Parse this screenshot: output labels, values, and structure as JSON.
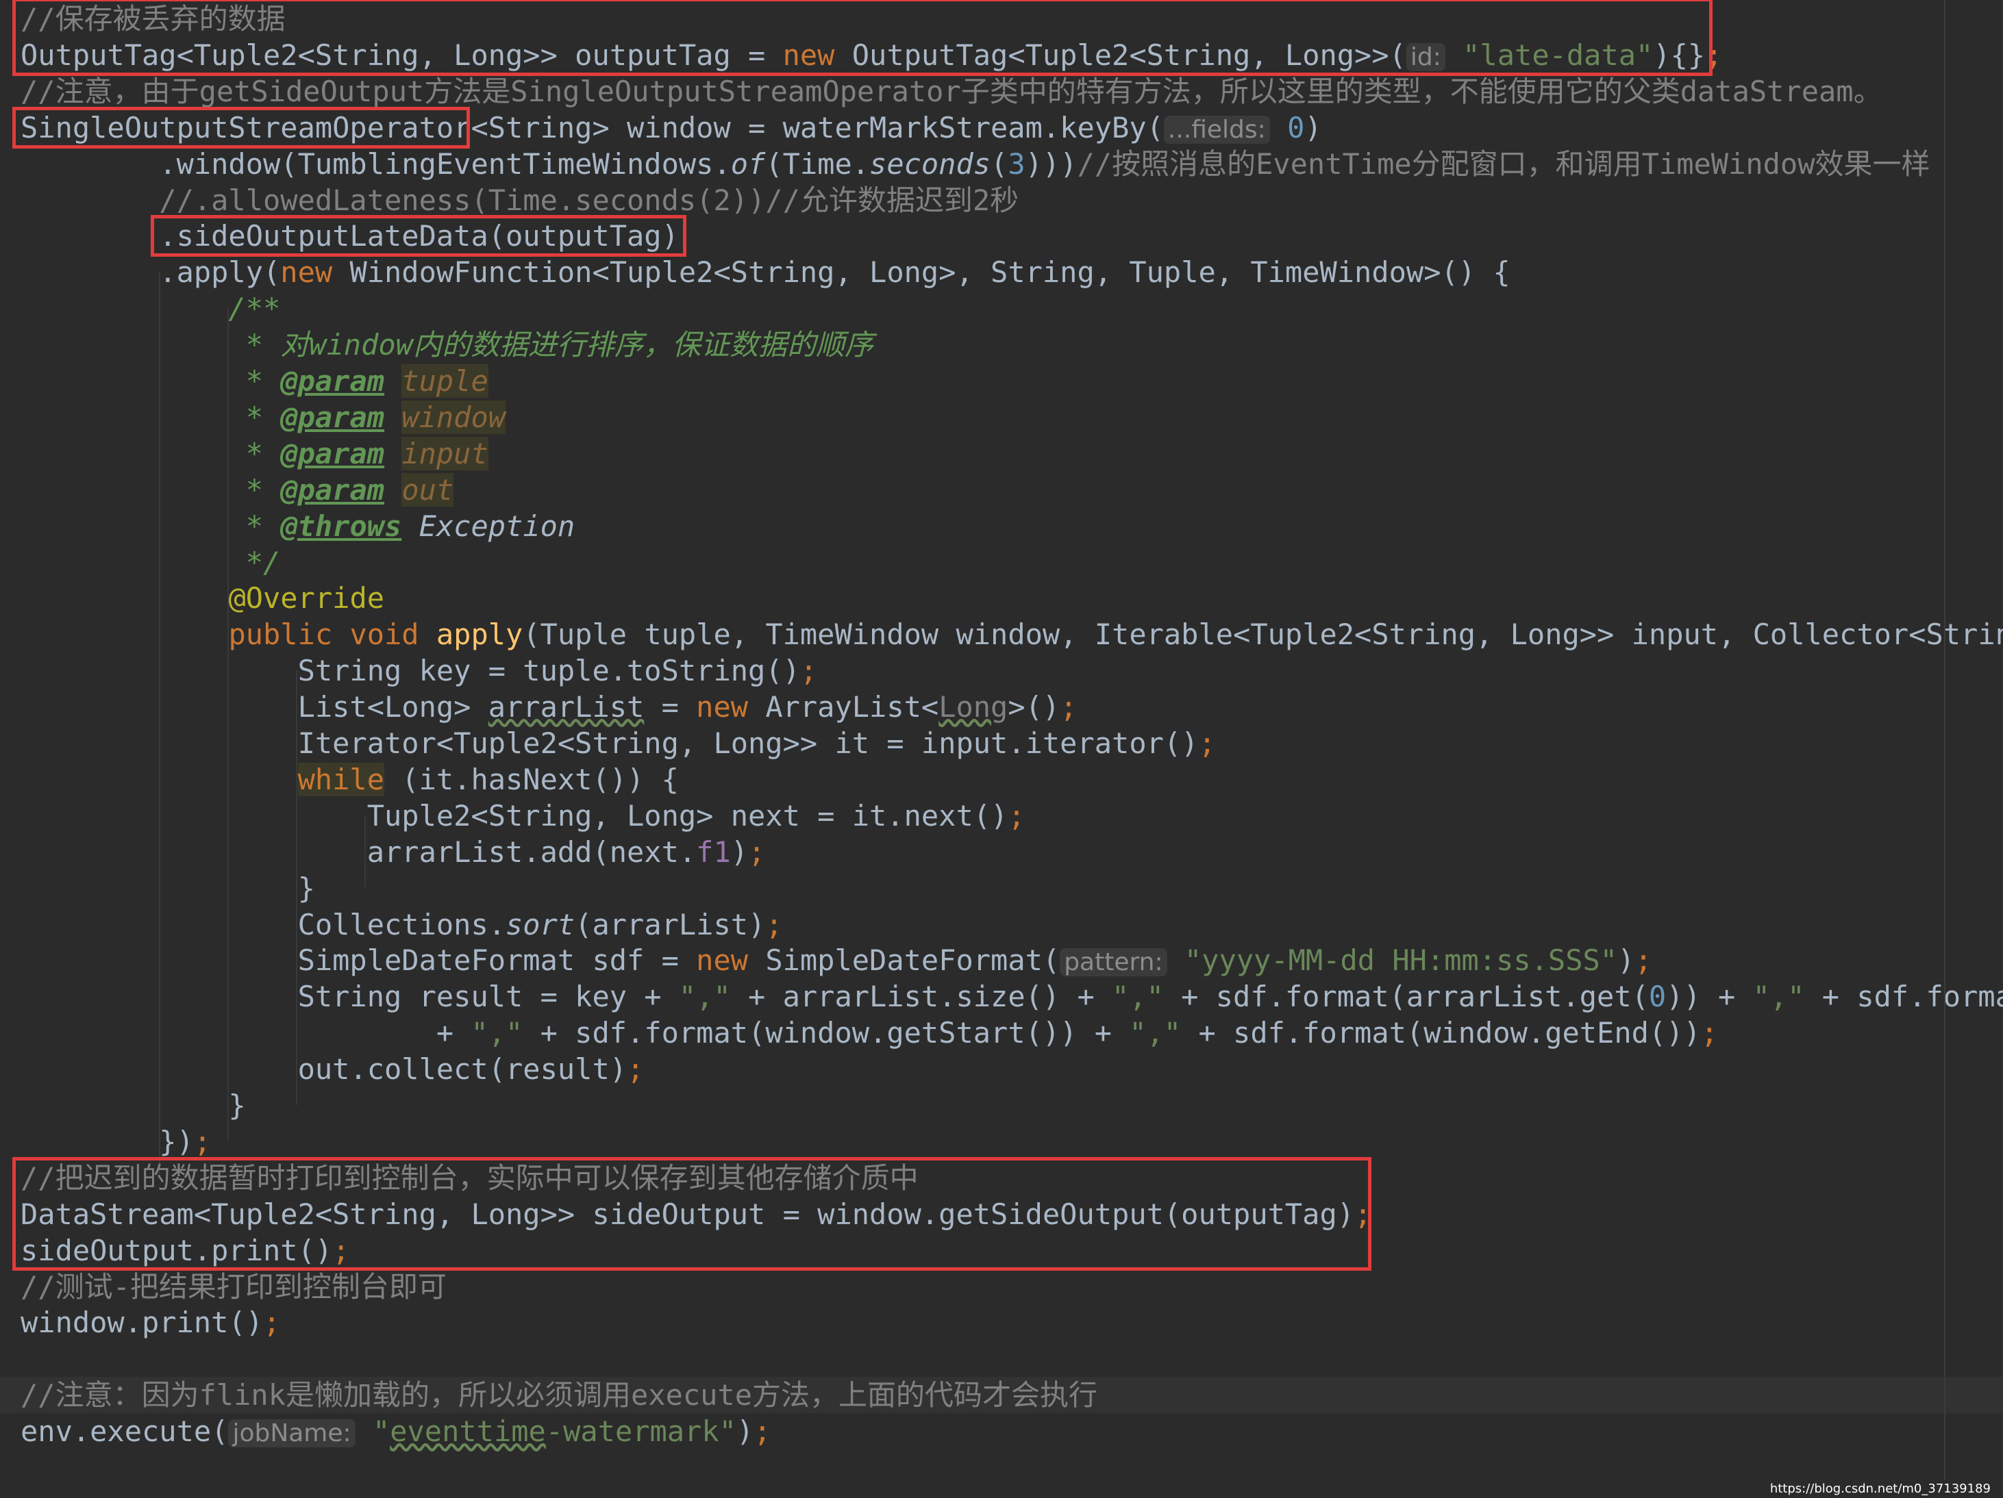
{
  "code_lines": [
    [
      {
        "t": "//保存被丢弃的数据",
        "s": "comment"
      }
    ],
    [
      {
        "t": "OutputTag<Tuple2<String, Long>> outputTag = ",
        "s": "normal"
      },
      {
        "t": "new ",
        "s": "keyword"
      },
      {
        "t": "OutputTag<Tuple2<String, Long>>(",
        "s": "normal"
      },
      {
        "t": "id:",
        "s": "hint"
      },
      {
        "t": " \"late-data\"",
        "s": "string"
      },
      {
        "t": "){}",
        "s": "normal"
      },
      {
        "t": ";",
        "s": "keyword"
      }
    ],
    [
      {
        "t": "//注意，由于getSideOutput方法是SingleOutputStreamOperator子类中的特有方法，所以这里的类型，不能使用它的父类dataStream。",
        "s": "comment"
      }
    ],
    [
      {
        "t": "SingleOutputStreamOperator<String> window = waterMarkStream.keyBy(",
        "s": "normal"
      },
      {
        "t": "...fields:",
        "s": "hint"
      },
      {
        "t": " 0",
        "s": "number"
      },
      {
        "t": ")",
        "s": "normal"
      }
    ],
    [
      {
        "t": "        .window(TumblingEventTimeWindows.",
        "s": "normal"
      },
      {
        "t": "of",
        "s": "italic"
      },
      {
        "t": "(Time.",
        "s": "normal"
      },
      {
        "t": "seconds",
        "s": "italic"
      },
      {
        "t": "(",
        "s": "normal"
      },
      {
        "t": "3",
        "s": "number"
      },
      {
        "t": ")))",
        "s": "normal"
      },
      {
        "t": "//按照消息的EventTime分配窗口，和调用TimeWindow效果一样",
        "s": "comment"
      }
    ],
    [
      {
        "t": "        //.allowedLateness(Time.seconds(2))//允许数据迟到2秒",
        "s": "comment"
      }
    ],
    [
      {
        "t": "        .sideOutputLateData(outputTag)",
        "s": "normal"
      }
    ],
    [
      {
        "t": "        .apply(",
        "s": "normal"
      },
      {
        "t": "new ",
        "s": "keyword"
      },
      {
        "t": "WindowFunction<Tuple2<String, Long>, String, Tuple, TimeWindow>() {",
        "s": "normal"
      }
    ],
    [
      {
        "t": "            /**",
        "s": "doc"
      }
    ],
    [
      {
        "t": "             * 对window内的数据进行排序，保证数据的顺序",
        "s": "doc"
      }
    ],
    [
      {
        "t": "             * ",
        "s": "doc"
      },
      {
        "t": "@param",
        "s": "doctag"
      },
      {
        "t": " ",
        "s": "doc"
      },
      {
        "t": "tuple",
        "s": "docparam"
      }
    ],
    [
      {
        "t": "             * ",
        "s": "doc"
      },
      {
        "t": "@param",
        "s": "doctag"
      },
      {
        "t": " ",
        "s": "doc"
      },
      {
        "t": "window",
        "s": "docparam"
      }
    ],
    [
      {
        "t": "             * ",
        "s": "doc"
      },
      {
        "t": "@param",
        "s": "doctag"
      },
      {
        "t": " ",
        "s": "doc"
      },
      {
        "t": "input",
        "s": "docparam"
      }
    ],
    [
      {
        "t": "             * ",
        "s": "doc"
      },
      {
        "t": "@param",
        "s": "doctag"
      },
      {
        "t": " ",
        "s": "doc"
      },
      {
        "t": "out",
        "s": "docparam"
      }
    ],
    [
      {
        "t": "             * ",
        "s": "doc"
      },
      {
        "t": "@throws",
        "s": "doctag"
      },
      {
        "t": " Exception",
        "s": "docref"
      }
    ],
    [
      {
        "t": "             */",
        "s": "doc"
      }
    ],
    [
      {
        "t": "            ",
        "s": "normal"
      },
      {
        "t": "@Override",
        "s": "annotation"
      }
    ],
    [
      {
        "t": "            ",
        "s": "normal"
      },
      {
        "t": "public void ",
        "s": "keyword"
      },
      {
        "t": "apply",
        "s": "method"
      },
      {
        "t": "(Tuple tuple, TimeWindow window, Iterable<Tuple2<String, Long>> input, Collector<String",
        "s": "normal"
      }
    ],
    [
      {
        "t": "                String key = tuple.toString()",
        "s": "normal"
      },
      {
        "t": ";",
        "s": "keyword"
      }
    ],
    [
      {
        "t": "                List<Long> ",
        "s": "normal"
      },
      {
        "t": "arrarList",
        "s": "typo"
      },
      {
        "t": " = ",
        "s": "normal"
      },
      {
        "t": "new ",
        "s": "keyword"
      },
      {
        "t": "ArrayList<",
        "s": "normal"
      },
      {
        "t": "Long",
        "s": "dimtype"
      },
      {
        "t": ">()",
        "s": "normal"
      },
      {
        "t": ";",
        "s": "keyword"
      }
    ],
    [
      {
        "t": "                Iterator<Tuple2<String, Long>> it = input.iterator()",
        "s": "normal"
      },
      {
        "t": ";",
        "s": "keyword"
      }
    ],
    [
      {
        "t": "                ",
        "s": "normal"
      },
      {
        "t": "while",
        "s": "hlkeyword"
      },
      {
        "t": " (it.hasNext()) {",
        "s": "normal"
      }
    ],
    [
      {
        "t": "                    Tuple2<String, Long> next = it.next()",
        "s": "normal"
      },
      {
        "t": ";",
        "s": "keyword"
      }
    ],
    [
      {
        "t": "                    arrarList.add(next.",
        "s": "normal"
      },
      {
        "t": "f1",
        "s": "field"
      },
      {
        "t": ")",
        "s": "normal"
      },
      {
        "t": ";",
        "s": "keyword"
      }
    ],
    [
      {
        "t": "                }",
        "s": "normal"
      }
    ],
    [
      {
        "t": "                Collections.",
        "s": "normal"
      },
      {
        "t": "sort",
        "s": "italic"
      },
      {
        "t": "(arrarList)",
        "s": "normal"
      },
      {
        "t": ";",
        "s": "keyword"
      }
    ],
    [
      {
        "t": "                SimpleDateFormat sdf = ",
        "s": "normal"
      },
      {
        "t": "new ",
        "s": "keyword"
      },
      {
        "t": "SimpleDateFormat(",
        "s": "normal"
      },
      {
        "t": "pattern:",
        "s": "hint"
      },
      {
        "t": " \"yyyy-MM-dd HH:mm:ss.SSS\"",
        "s": "string"
      },
      {
        "t": ")",
        "s": "normal"
      },
      {
        "t": ";",
        "s": "keyword"
      }
    ],
    [
      {
        "t": "                String result = key + ",
        "s": "normal"
      },
      {
        "t": "\",\"",
        "s": "string"
      },
      {
        "t": " + arrarList.size() + ",
        "s": "normal"
      },
      {
        "t": "\",\"",
        "s": "string"
      },
      {
        "t": " + sdf.format(arrarList.get(",
        "s": "normal"
      },
      {
        "t": "0",
        "s": "number"
      },
      {
        "t": ")) + ",
        "s": "normal"
      },
      {
        "t": "\",\"",
        "s": "string"
      },
      {
        "t": " + sdf.format",
        "s": "normal"
      }
    ],
    [
      {
        "t": "                        + ",
        "s": "normal"
      },
      {
        "t": "\",\"",
        "s": "string"
      },
      {
        "t": " + sdf.format(window.getStart()) + ",
        "s": "normal"
      },
      {
        "t": "\",\"",
        "s": "string"
      },
      {
        "t": " + sdf.format(window.getEnd())",
        "s": "normal"
      },
      {
        "t": ";",
        "s": "keyword"
      }
    ],
    [
      {
        "t": "                out.collect(result)",
        "s": "normal"
      },
      {
        "t": ";",
        "s": "keyword"
      }
    ],
    [
      {
        "t": "            }",
        "s": "normal"
      }
    ],
    [
      {
        "t": "        })",
        "s": "normal"
      },
      {
        "t": ";",
        "s": "keyword"
      }
    ],
    [
      {
        "t": "//把迟到的数据暂时打印到控制台，实际中可以保存到其他存储介质中",
        "s": "comment"
      }
    ],
    [
      {
        "t": "DataStream<Tuple2<String, Long>> sideOutput = window.getSideOutput(outputTag)",
        "s": "normal"
      },
      {
        "t": ";",
        "s": "keyword"
      }
    ],
    [
      {
        "t": "sideOutput.print()",
        "s": "normal"
      },
      {
        "t": ";",
        "s": "keyword"
      }
    ],
    [
      {
        "t": "//测试-把结果打印到控制台即可",
        "s": "comment"
      }
    ],
    [
      {
        "t": "window.print()",
        "s": "normal"
      },
      {
        "t": ";",
        "s": "keyword"
      }
    ],
    [
      {
        "t": "",
        "s": "normal"
      }
    ],
    [
      {
        "t": "//注意：因为flink是懒加载的，所以必须调用execute方法，上面的代码才会执行",
        "s": "comment"
      }
    ],
    [
      {
        "t": "env.execute(",
        "s": "normal"
      },
      {
        "t": "jobName:",
        "s": "hint"
      },
      {
        "t": " \"",
        "s": "string"
      },
      {
        "t": "eventtime",
        "s": "stringtypo"
      },
      {
        "t": "-watermark\"",
        "s": "string"
      },
      {
        "t": ")",
        "s": "normal"
      },
      {
        "t": ";",
        "s": "keyword"
      }
    ]
  ],
  "current_line_index": 38,
  "highlight_boxes": [
    {
      "name": "outputtag-declaration",
      "first_line": 0,
      "last_line": 1
    },
    {
      "name": "operator-type",
      "first_line": 3,
      "last_line": 3
    },
    {
      "name": "side-output-late-data",
      "first_line": 6,
      "last_line": 6
    },
    {
      "name": "side-output-print-block",
      "first_line": 32,
      "last_line": 34
    }
  ],
  "watermark": "https://blog.csdn.net/m0_37139189",
  "colors": {
    "background": "#2b2b2b",
    "text": "#a9b7c6",
    "keyword": "#cc7832",
    "string": "#6a8759",
    "comment": "#808080",
    "doc_comment": "#629755",
    "number": "#6897bb",
    "annotation": "#bbb529",
    "method": "#ffc66d",
    "highlight_box": "#e23c3c"
  }
}
